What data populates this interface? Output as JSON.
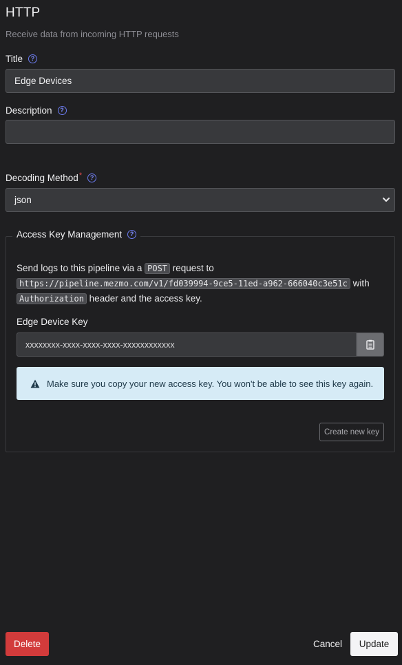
{
  "header": {
    "title": "HTTP",
    "subtitle": "Receive data from incoming HTTP requests"
  },
  "fields": {
    "title_label": "Title",
    "title_value": "Edge Devices",
    "description_label": "Description",
    "description_value": "",
    "decoding_label": "Decoding Method",
    "decoding_required": "*",
    "decoding_value": "json"
  },
  "access_key": {
    "legend": "Access Key Management",
    "text_1": "Send logs to this pipeline via a ",
    "method": "POST",
    "text_2": " request to",
    "url": "https://pipeline.mezmo.com/v1/fd039994-9ce5-11ed-a962-666040c3e51c",
    "text_3": " with",
    "auth_header": "Authorization",
    "text_4": " header and the access key.",
    "key_label": "Edge Device Key",
    "key_value": "xxxxxxxx-xxxx-xxxx-xxxx-xxxxxxxxxxxx",
    "alert_text": "Make sure you copy your new access key. You won't be able to see this key again.",
    "create_button": "Create new key"
  },
  "footer": {
    "delete_label": "Delete",
    "cancel_label": "Cancel",
    "update_label": "Update"
  },
  "icons": {
    "help": "question-circle-icon",
    "copy": "clipboard-icon",
    "warning": "warning-triangle-icon",
    "chevron": "chevron-down-icon"
  },
  "colors": {
    "background": "#1f1f21",
    "input_bg": "#38393c",
    "help_icon": "#6b7bf0",
    "delete": "#d23b3b",
    "alert_bg": "#d6ebf6",
    "update_bg": "#f4f4f6"
  }
}
